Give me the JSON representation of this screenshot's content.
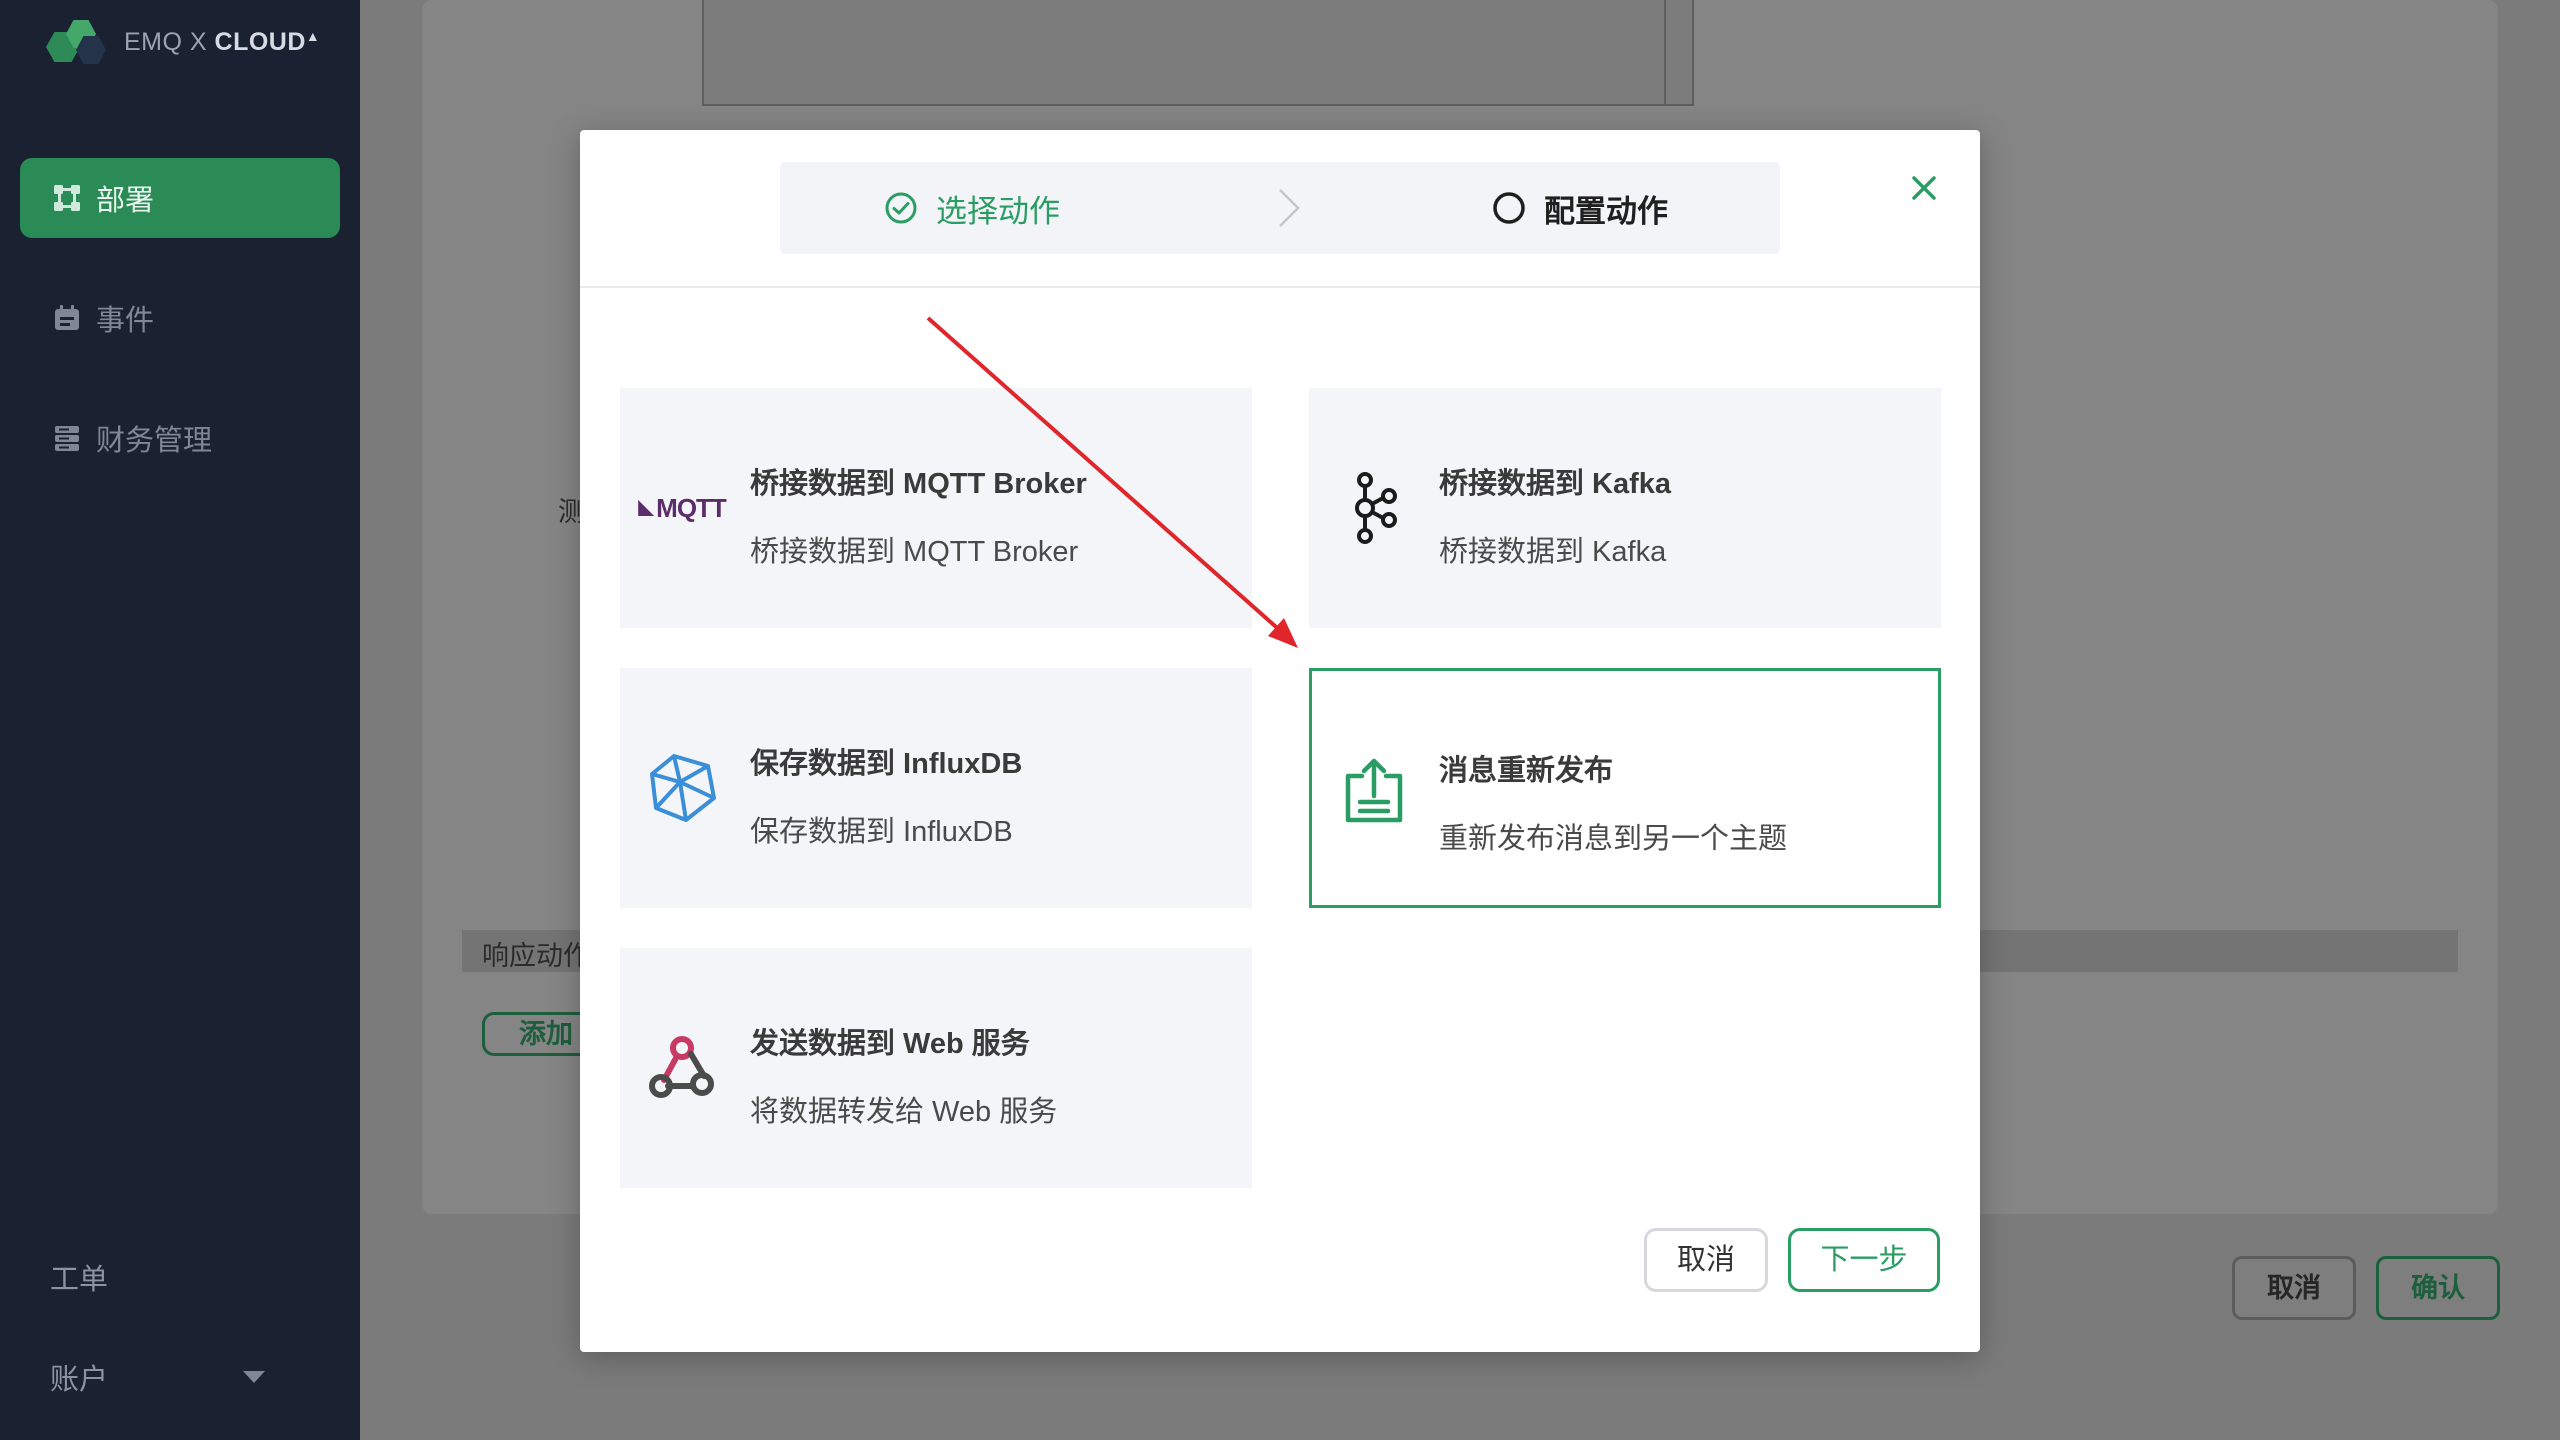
{
  "app": {
    "logo_prefix": "EMQ X ",
    "logo_brand": "CLOUD"
  },
  "sidebar": {
    "items": [
      {
        "label": "部署",
        "icon": "deploy-icon",
        "active": true
      },
      {
        "label": "事件",
        "icon": "calendar-icon",
        "active": false
      },
      {
        "label": "财务管理",
        "icon": "server-icon",
        "active": false
      }
    ],
    "bottom": {
      "ticket": "工单",
      "account": "账户"
    }
  },
  "background": {
    "test_label": "测",
    "response_label": "响应动作",
    "add_button": "添加动作",
    "cancel_button": "取消",
    "confirm_button": "确认"
  },
  "modal": {
    "steps": [
      {
        "label": "选择动作",
        "state": "done"
      },
      {
        "label": "配置动作",
        "state": "pending"
      }
    ],
    "cards": [
      {
        "title": "桥接数据到 MQTT Broker",
        "desc": "桥接数据到 MQTT Broker",
        "icon": "mqtt-logo-icon",
        "logo_text": "MQTT",
        "selected": false
      },
      {
        "title": "桥接数据到 Kafka",
        "desc": "桥接数据到 Kafka",
        "icon": "kafka-icon",
        "selected": false
      },
      {
        "title": "保存数据到 InfluxDB",
        "desc": "保存数据到 InfluxDB",
        "icon": "influxdb-icon",
        "selected": false
      },
      {
        "title": "消息重新发布",
        "desc": "重新发布消息到另一个主题",
        "icon": "republish-icon",
        "selected": true
      },
      {
        "title": "发送数据到 Web 服务",
        "desc": "将数据转发给 Web 服务",
        "icon": "webhook-icon",
        "selected": false
      }
    ],
    "cancel_button": "取消",
    "next_button": "下一步"
  },
  "colors": {
    "accent": "#2a9d64",
    "sidebar_bg": "#1a2130",
    "annotation_arrow": "#e0262b"
  }
}
